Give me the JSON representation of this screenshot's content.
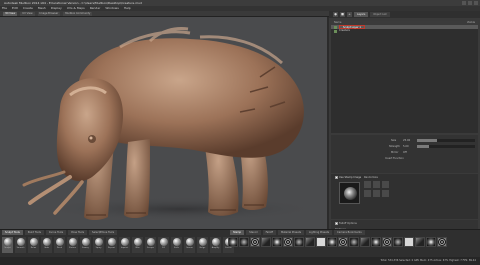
{
  "window": {
    "title": "Autodesk Mudbox 2014 x64 - Educational Version - C:\\Users\\Mudbox\\Desktop\\Creature.mud"
  },
  "menu": [
    "File",
    "Edit",
    "Create",
    "Mesh",
    "Display",
    "UVs & Maps",
    "Render",
    "Windows",
    "Help"
  ],
  "toolbar": {
    "tabs": [
      "3D View",
      "UV View",
      "Image Browser",
      "Mudbox Community"
    ],
    "active": "3D View"
  },
  "right_panel": {
    "tabs": [
      "Layers",
      "Object List"
    ],
    "active_tab": "Layers",
    "outliner_header": {
      "name": "Name",
      "visible": "Visible"
    },
    "layers": [
      {
        "name": "Sculpt Layer 1",
        "selected": true
      },
      {
        "name": "Creature",
        "selected": false
      }
    ],
    "properties": [
      {
        "label": "Size",
        "value": "25.00",
        "level": 0.35
      },
      {
        "label": "Strength",
        "value": "5.00",
        "level": 0.2
      },
      {
        "label": "Mirror",
        "value": "Off"
      },
      {
        "label": "Invert Function"
      }
    ],
    "stamp": {
      "label": "Use Stamp Image",
      "checked": true,
      "options": "Randomize"
    },
    "falloff": {
      "label": "Falloff Options",
      "value": "Distance",
      "checked": true
    }
  },
  "shelf": {
    "tabs": [
      "Sculpt Tools",
      "Paint Tools",
      "Curve Tools",
      "Pose Tools",
      "Select/Move Tools"
    ],
    "active_tab": "Sculpt Tools",
    "tools": [
      "Sculpt",
      "Smooth",
      "Relax",
      "Grab",
      "Pinch",
      "Flatten",
      "Foamy",
      "Spray",
      "Repeat",
      "Imprint",
      "Wax",
      "Scrape",
      "Fill",
      "Knife",
      "Smear",
      "Bulge",
      "Amplify",
      "Freeze",
      "Mask",
      "Erase"
    ],
    "active_tool": "Sculpt",
    "stamp_tabs": [
      "Stamp",
      "Stencil",
      "Falloff",
      "Material Presets",
      "Lighting Presets",
      "Camera Bookmarks"
    ],
    "active_stamp_tab": "Stamp"
  },
  "status": {
    "text": "Total: 534,336  Selected: 0  GPU Mem: 475  Active: 67%  Highest: 7  FPS: 89.44"
  },
  "colors": {
    "viewport_bg": "#4a4b4d",
    "panel_bg": "#3a3a3a",
    "selection_outline": "#c0392b",
    "model": "#a07860"
  },
  "icons": {
    "window_minimize": "minimize-icon",
    "window_maximize": "maximize-icon",
    "window_close": "close-icon",
    "tool_ball": "sculpt-ball-icon"
  }
}
